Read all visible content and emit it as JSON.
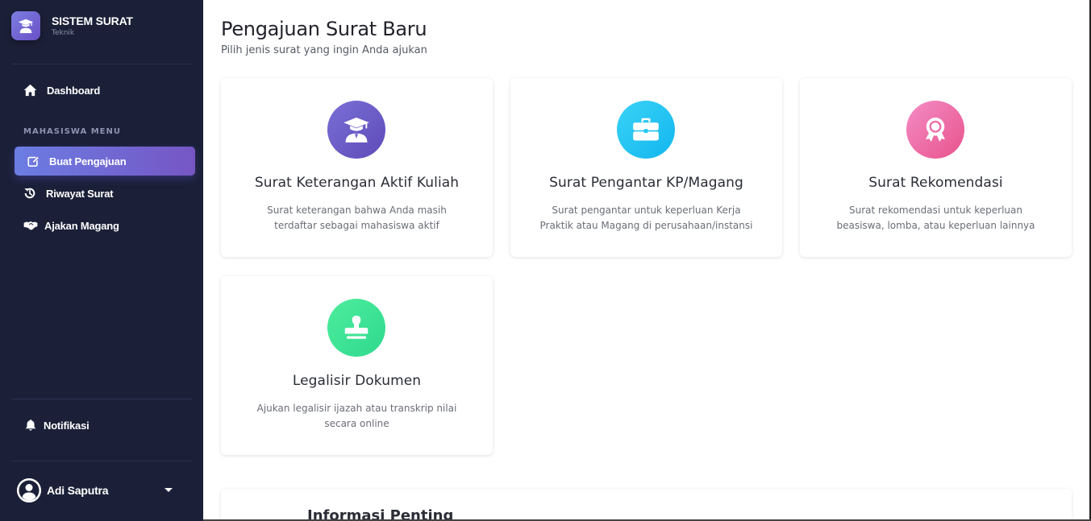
{
  "brand": {
    "title": "SISTEM SURAT",
    "subtitle": "Teknik"
  },
  "sidebar": {
    "dashboard": "Dashboard",
    "section_label": "MAHASISWA MENU",
    "items": [
      {
        "label": "Buat Pengajuan",
        "icon": "edit-icon",
        "active": true
      },
      {
        "label": "Riwayat Surat",
        "icon": "history-icon",
        "active": false
      },
      {
        "label": "Ajakan Magang",
        "icon": "handshake-icon",
        "active": false
      }
    ],
    "notifications": "Notifikasi",
    "user": {
      "name": "Adi Saputra"
    },
    "accent_color": "#6b7de3",
    "background_color": "#1b2038"
  },
  "main": {
    "title": "Pengajuan Surat Baru",
    "subtitle": "Pilih jenis surat yang ingin Anda ajukan",
    "cards": [
      {
        "title": "Surat Keterangan Aktif Kuliah",
        "description": "Surat keterangan bahwa Anda masih terdaftar sebagai mahasiswa aktif",
        "icon": "graduate-icon",
        "color": "#6a5bc9"
      },
      {
        "title": "Surat Pengantar KP/Magang",
        "description": "Surat pengantar untuk keperluan Kerja Praktik atau Magang di perusahaan/instansi",
        "icon": "briefcase-icon",
        "color": "#1ec8f3"
      },
      {
        "title": "Surat Rekomendasi",
        "description": "Surat rekomendasi untuk keperluan beasiswa, lomba, atau keperluan lainnya",
        "icon": "award-icon",
        "color": "#ee6aa7"
      },
      {
        "title": "Legalisir Dokumen",
        "description": "Ajukan legalisir ijazah atau transkrip nilai secara online",
        "icon": "stamp-icon",
        "color": "#3ee497"
      }
    ],
    "info_title": "Informasi Penting"
  }
}
